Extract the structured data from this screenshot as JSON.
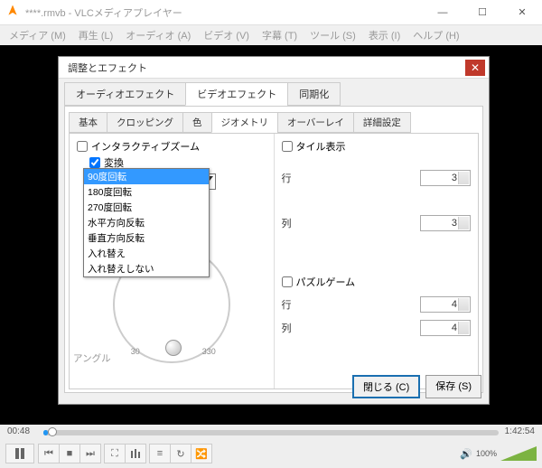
{
  "window": {
    "title": "****.rmvb - VLCメディアプレイヤー",
    "min": "—",
    "max": "☐",
    "close": "✕"
  },
  "menu": {
    "media": "メディア (M)",
    "playback": "再生 (L)",
    "audio": "オーディオ (A)",
    "video": "ビデオ (V)",
    "subtitle": "字幕 (T)",
    "tools": "ツール (S)",
    "view": "表示 (I)",
    "help": "ヘルプ (H)"
  },
  "dialog": {
    "title": "調整とエフェクト",
    "tabs": {
      "audio": "オーディオエフェクト",
      "video": "ビデオエフェクト",
      "sync": "同期化"
    },
    "subtabs": {
      "basic": "基本",
      "crop": "クロッピング",
      "color": "色",
      "geom": "ジオメトリ",
      "overlay": "オーバーレイ",
      "adv": "詳細設定"
    },
    "geom": {
      "zoom": "インタラクティブズーム",
      "transform": "変換",
      "combo": "90度回転",
      "options": {
        "o0": "90度回転",
        "o1": "180度回転",
        "o2": "270度回転",
        "o3": "水平方向反転",
        "o4": "垂直方向反転",
        "o5": "入れ替え",
        "o6": "入れ替えしない"
      },
      "angle": "アングル",
      "d30": "30",
      "d330": "330"
    },
    "tile": {
      "label": "タイル表示",
      "row": "行",
      "col": "列",
      "v1": "3",
      "v2": "3"
    },
    "puzzle": {
      "label": "パズルゲーム",
      "row": "行",
      "col": "列",
      "v1": "4",
      "v2": "4"
    },
    "close": "閉じる (C)",
    "save": "保存 (S)"
  },
  "player": {
    "elapsed": "00:48",
    "total": "1:42:54",
    "vol": "100%"
  }
}
